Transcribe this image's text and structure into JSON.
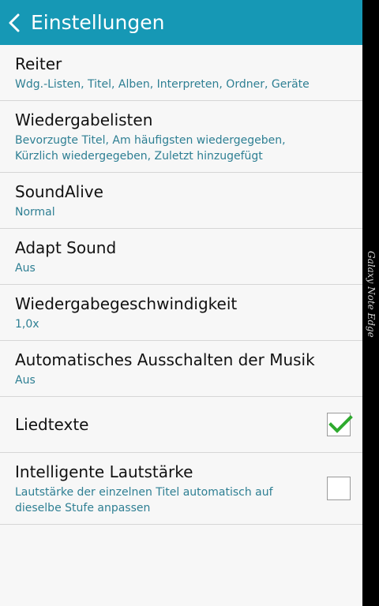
{
  "header": {
    "title": "Einstellungen",
    "back_icon": "chevron-left-icon",
    "background": "#1698b5"
  },
  "device_edge": {
    "label": "Galaxy Note Edge"
  },
  "settings": [
    {
      "label": "Reiter",
      "summary": "Wdg.-Listen, Titel, Alben, Interpreten, Ordner, Geräte"
    },
    {
      "label": "Wiedergabelisten",
      "summary": "Bevorzugte Titel, Am häufigsten wiedergegeben, Kürzlich wiedergegeben, Zuletzt hinzugefügt"
    },
    {
      "label": "SoundAlive",
      "summary": "Normal"
    },
    {
      "label": "Adapt Sound",
      "summary": "Aus"
    },
    {
      "label": "Wiedergabegeschwindigkeit",
      "summary": "1,0x"
    },
    {
      "label": "Automatisches Ausschalten der Musik",
      "summary": "Aus"
    },
    {
      "label": "Liedtexte",
      "checked": true
    },
    {
      "label": "Intelligente Lautstärke",
      "summary": "Lautstärke der einzelnen Titel automatisch auf dieselbe Stufe anpassen",
      "checked": false
    }
  ],
  "colors": {
    "summary_text": "#2e7f93",
    "check_green": "#2eaa2e"
  }
}
